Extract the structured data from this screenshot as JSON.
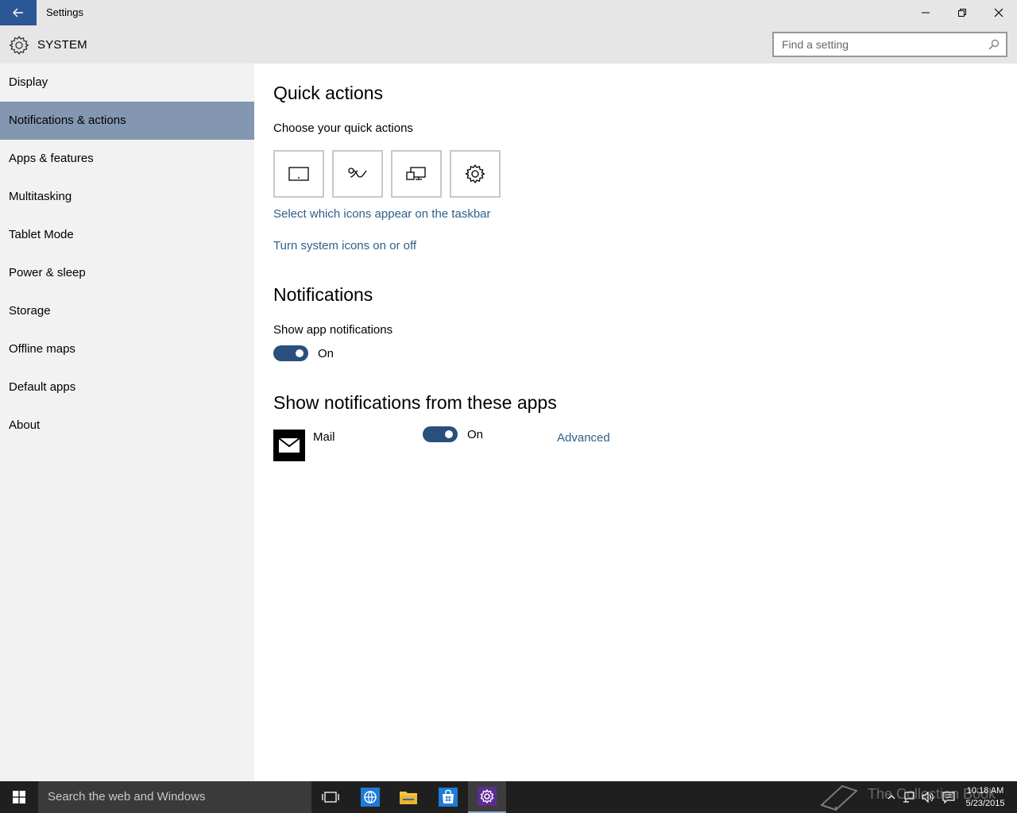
{
  "window": {
    "title": "Settings",
    "buttons": {
      "minimize": "minimize-icon",
      "restore": "restore-icon",
      "close": "close-icon"
    }
  },
  "header": {
    "title": "SYSTEM",
    "search_placeholder": "Find a setting"
  },
  "sidebar": {
    "items": [
      {
        "label": "Display"
      },
      {
        "label": "Notifications & actions",
        "active": true
      },
      {
        "label": "Apps & features"
      },
      {
        "label": "Multitasking"
      },
      {
        "label": "Tablet Mode"
      },
      {
        "label": "Power & sleep"
      },
      {
        "label": "Storage"
      },
      {
        "label": "Offline maps"
      },
      {
        "label": "Default apps"
      },
      {
        "label": "About"
      }
    ]
  },
  "quick_actions": {
    "heading": "Quick actions",
    "subheading": "Choose your quick actions",
    "tiles": [
      {
        "icon": "tablet-mode-icon"
      },
      {
        "icon": "connect-icon"
      },
      {
        "icon": "project-icon"
      },
      {
        "icon": "all-settings-icon"
      }
    ],
    "link_taskbar": "Select which icons appear on the taskbar",
    "link_system_icons": "Turn system icons on or off"
  },
  "notifications": {
    "heading": "Notifications",
    "show_app_label": "Show app notifications",
    "show_app_state": "On"
  },
  "apps_section": {
    "heading": "Show notifications from these apps",
    "apps": [
      {
        "name": "Mail",
        "state": "On",
        "advanced": "Advanced",
        "icon": "mail-icon"
      }
    ]
  },
  "taskbar": {
    "search_text": "Search the web and Windows",
    "watermark": "The Collection Book",
    "time": "10:18 AM",
    "date": "5/23/2015"
  },
  "colors": {
    "accent": "#2b5797",
    "sidebar_active": "#8397b1",
    "toggle_on": "#2b4f7c",
    "link": "#2e5f8a"
  }
}
